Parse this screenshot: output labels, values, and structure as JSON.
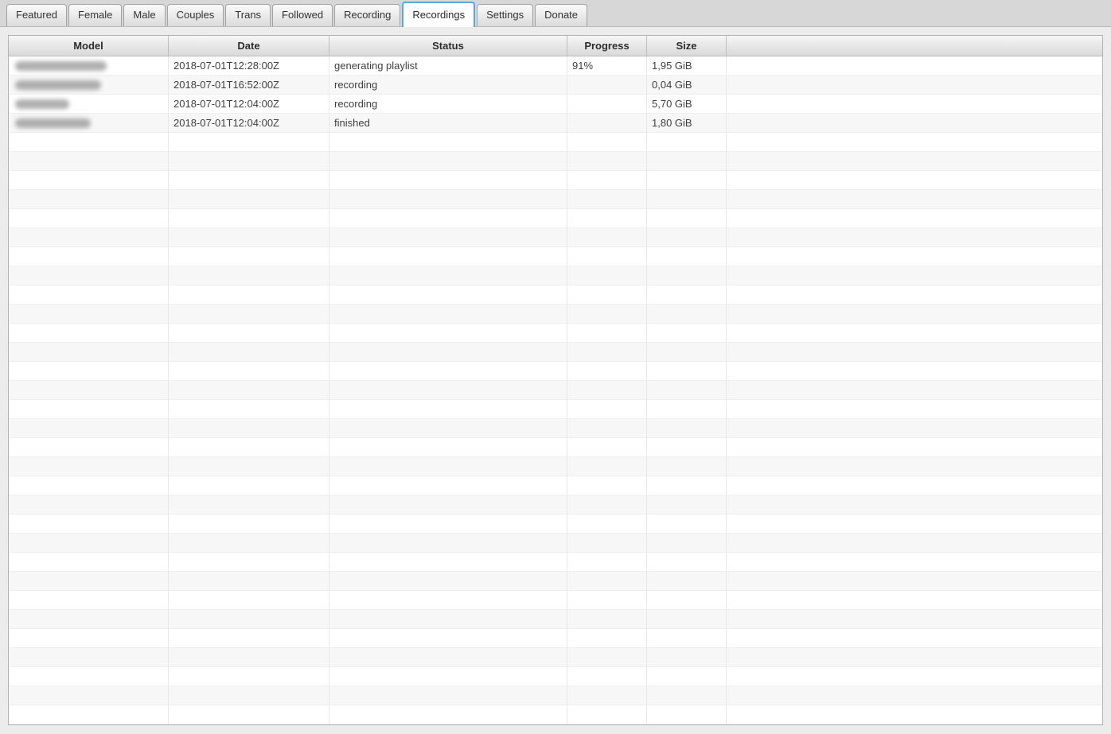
{
  "tabs": {
    "items": [
      "Featured",
      "Female",
      "Male",
      "Couples",
      "Trans",
      "Followed",
      "Recording",
      "Recordings",
      "Settings",
      "Donate"
    ],
    "active": "Recordings"
  },
  "table": {
    "columns": {
      "model": "Model",
      "date": "Date",
      "status": "Status",
      "progress": "Progress",
      "size": "Size"
    },
    "rows": [
      {
        "model_redacted": true,
        "model_blur_width": 115,
        "date": "2018-07-01T12:28:00Z",
        "status": "generating playlist",
        "progress": "91%",
        "size": "1,95 GiB"
      },
      {
        "model_redacted": true,
        "model_blur_width": 108,
        "date": "2018-07-01T16:52:00Z",
        "status": "recording",
        "progress": "",
        "size": "0,04 GiB"
      },
      {
        "model_redacted": true,
        "model_blur_width": 68,
        "date": "2018-07-01T12:04:00Z",
        "status": "recording",
        "progress": "",
        "size": "5,70 GiB"
      },
      {
        "model_redacted": true,
        "model_blur_width": 95,
        "date": "2018-07-01T12:04:00Z",
        "status": "finished",
        "progress": "",
        "size": "1,80 GiB"
      }
    ],
    "empty_row_count": 31
  },
  "colors": {
    "active_tab_border": "#55aadd",
    "row_stripe": "#f7f7f7",
    "header_gradient_top": "#f6f6f6",
    "header_gradient_bottom": "#d9d9d9"
  }
}
